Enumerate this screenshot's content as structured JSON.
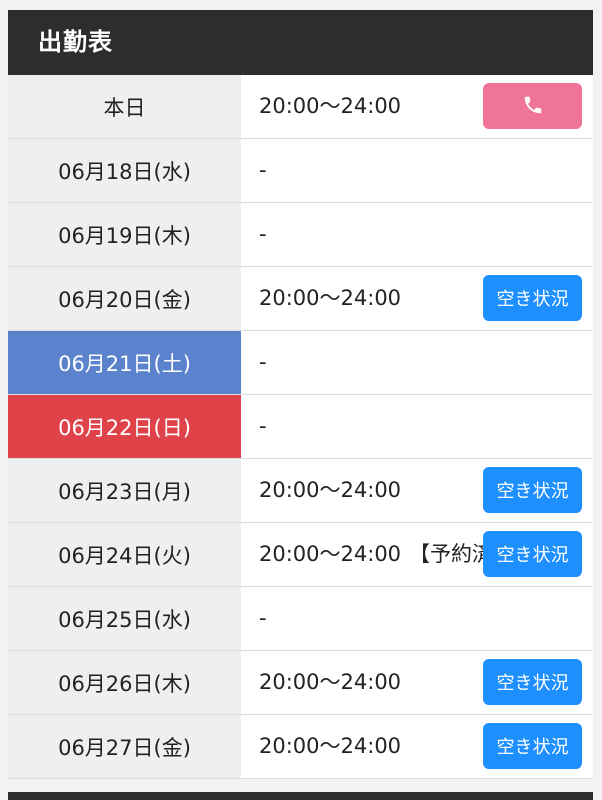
{
  "header": {
    "title": "出勤表"
  },
  "colors": {
    "header_bg": "#2d2d2d",
    "date_cell_bg": "#efefef",
    "saturday_bg": "#5b82cc",
    "sunday_bg": "#e0424a",
    "phone_button_bg": "#f07497",
    "availability_button_bg": "#1e8fff"
  },
  "schedule": {
    "rows": [
      {
        "date": "本日",
        "time": "20:00〜24:00",
        "note": "",
        "button": "phone",
        "day_type": "normal"
      },
      {
        "date": "06月18日(水)",
        "time": "-",
        "note": "",
        "button": "",
        "day_type": "normal"
      },
      {
        "date": "06月19日(木)",
        "time": "-",
        "note": "",
        "button": "",
        "day_type": "normal"
      },
      {
        "date": "06月20日(金)",
        "time": "20:00〜24:00",
        "note": "",
        "button": "空き状況",
        "day_type": "normal"
      },
      {
        "date": "06月21日(土)",
        "time": "-",
        "note": "",
        "button": "",
        "day_type": "saturday"
      },
      {
        "date": "06月22日(日)",
        "time": "-",
        "note": "",
        "button": "",
        "day_type": "sunday"
      },
      {
        "date": "06月23日(月)",
        "time": "20:00〜24:00",
        "note": "",
        "button": "空き状況",
        "day_type": "normal"
      },
      {
        "date": "06月24日(火)",
        "time": "20:00〜24:00",
        "note": "【予約済",
        "button": "空き状況",
        "day_type": "normal"
      },
      {
        "date": "06月25日(水)",
        "time": "-",
        "note": "",
        "button": "",
        "day_type": "normal"
      },
      {
        "date": "06月26日(木)",
        "time": "20:00〜24:00",
        "note": "",
        "button": "空き状況",
        "day_type": "normal"
      },
      {
        "date": "06月27日(金)",
        "time": "20:00〜24:00",
        "note": "",
        "button": "空き状況",
        "day_type": "normal"
      }
    ]
  }
}
